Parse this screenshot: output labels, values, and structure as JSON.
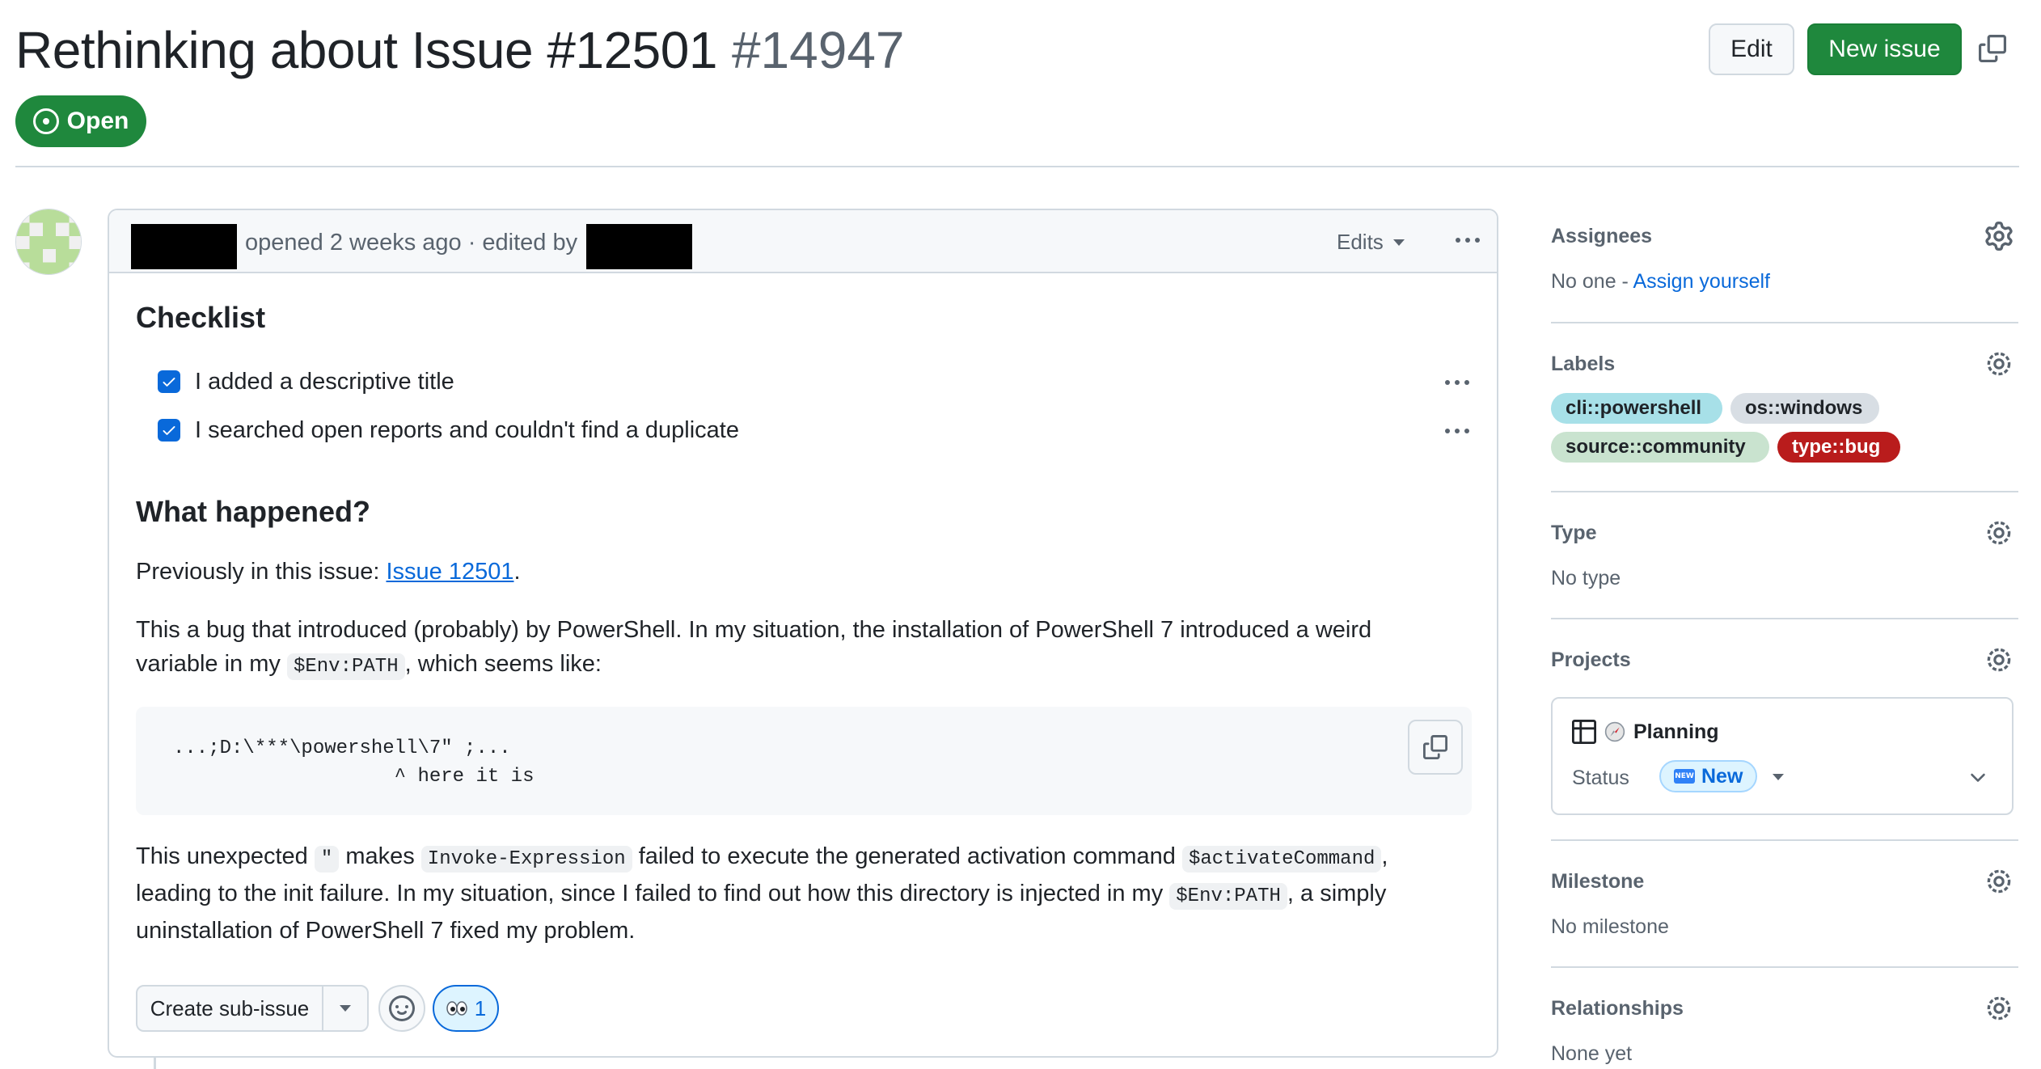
{
  "header": {
    "title": "Rethinking about Issue #12501",
    "number": "#14947",
    "state": "Open",
    "edit_label": "Edit",
    "new_issue_label": "New issue"
  },
  "comment": {
    "opened_text": "opened 2 weeks ago · edited by",
    "edits_label": "Edits",
    "checklist_heading": "Checklist",
    "tasks": [
      {
        "label": "I added a descriptive title",
        "checked": true
      },
      {
        "label": "I searched open reports and couldn't find a duplicate",
        "checked": true
      }
    ],
    "what_happened_heading": "What happened?",
    "previously_prefix": "Previously in this issue: ",
    "previously_link": "Issue 12501",
    "previously_suffix": ".",
    "bug_line1": "This a bug that introduced (probably) by PowerShell. In my situation, the installation of PowerShell 7 introduced a weird",
    "bug_line2_prefix": "variable in my ",
    "bug_line2_code": "$Env:PATH",
    "bug_line2_suffix": ", which seems like:",
    "code_block": "...;D:\\***\\powershell\\7\" ;...\n                   ^ here it is",
    "unexpected_line1_a": "This unexpected ",
    "unexpected_line1_code1": "\"",
    "unexpected_line1_b": " makes ",
    "unexpected_line1_code2": "Invoke-Expression",
    "unexpected_line1_c": " failed to execute the generated activation command ",
    "unexpected_line1_code3": "$activateCommand",
    "unexpected_line1_d": ",",
    "unexpected_line2_a": "leading to the init failure. In my situation, since I failed to find out how this directory is injected in my ",
    "unexpected_line2_code": "$Env:PATH",
    "unexpected_line2_b": ", a simply",
    "unexpected_line3": "uninstallation of PowerShell 7 fixed my problem.",
    "create_sub_issue_label": "Create sub-issue",
    "reaction_eyes_count": "1"
  },
  "sidebar": {
    "assignees": {
      "title": "Assignees",
      "value_prefix": "No one - ",
      "assign_link": "Assign yourself"
    },
    "labels": {
      "title": "Labels",
      "items": [
        {
          "name": "cli::powershell",
          "color": "#a7e0e8"
        },
        {
          "name": "os::windows",
          "color": "#d8dee4"
        },
        {
          "name": "source::community",
          "color": "#c9e3cf"
        },
        {
          "name": "type::bug",
          "color": "#b91c1c"
        }
      ]
    },
    "type": {
      "title": "Type",
      "value": "No type"
    },
    "projects": {
      "title": "Projects",
      "project_name": "Planning",
      "status_label": "Status",
      "status_value": "New"
    },
    "milestone": {
      "title": "Milestone",
      "value": "No milestone"
    },
    "relationships": {
      "title": "Relationships",
      "value": "None yet"
    }
  },
  "colors": {
    "open_green": "#1f883d",
    "link_blue": "#0969da",
    "muted_text": "#59636e",
    "border": "#d1d9e0"
  }
}
